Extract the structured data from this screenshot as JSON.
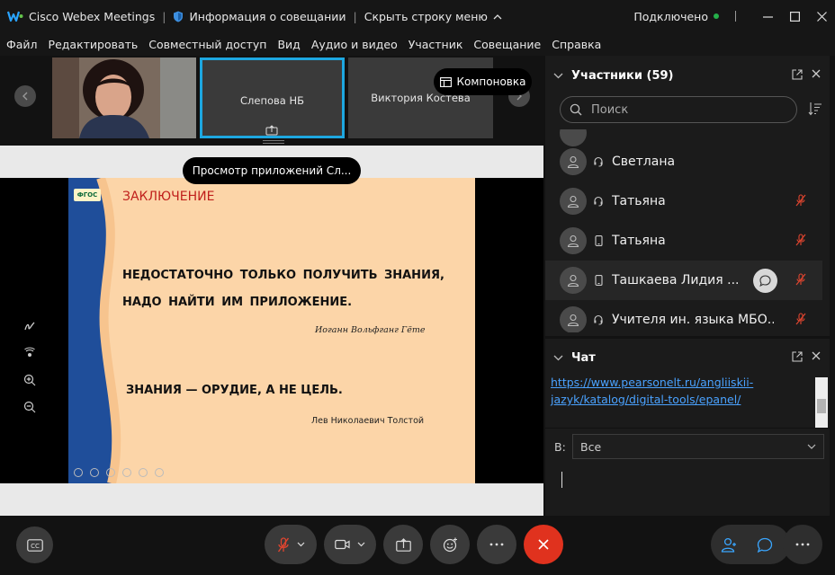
{
  "titlebar": {
    "app_name": "Cisco Webex Meetings",
    "meeting_info": "Информация о совещании",
    "hide_menu": "Скрыть строку меню",
    "status": "Подключено",
    "status_color": "#25b04a"
  },
  "menu": [
    "Файл",
    "Редактировать",
    "Совместный доступ",
    "Вид",
    "Аудио и видео",
    "Участник",
    "Совещание",
    "Справка"
  ],
  "thumbnails": [
    {
      "name": ""
    },
    {
      "name": "Слепова НБ"
    },
    {
      "name": "Виктория Костева"
    }
  ],
  "layout_button": "Компоновка",
  "share_tip": "Просмотр приложений Сл...",
  "slide": {
    "badge": "ФГОС",
    "title": "ЗАКЛЮЧЕНИЕ",
    "quote1_line1": "НЕДОСТАТОЧНО ТОЛЬКО ПОЛУЧИТЬ ЗНАНИЯ,",
    "quote1_line2": "НАДО НАЙТИ ИМ ПРИЛОЖЕНИЕ.",
    "author1": "Иоганн Вольфганг Гёте",
    "quote2": "ЗНАНИЯ — ОРУДИЕ, А НЕ ЦЕЛЬ.",
    "author2": "Лев Николаевич Толстой"
  },
  "participants": {
    "title": "Участники (59)",
    "search_placeholder": "Поиск",
    "list": [
      {
        "name": "Светлана",
        "device": "headset",
        "muted": false
      },
      {
        "name": "Татьяна",
        "device": "headset",
        "muted": true
      },
      {
        "name": "Татьяна",
        "device": "phone",
        "muted": true
      },
      {
        "name": "Ташкаева Лидия ...",
        "device": "phone",
        "muted": true
      },
      {
        "name": "Учителя ин. языка МБО...",
        "device": "headset",
        "muted": true
      }
    ]
  },
  "chat": {
    "title": "Чат",
    "link_text": "https://www.pearsonelt.ru/angliiskii-jazyk/katalog/digital-tools/epanel/",
    "to_label": "В:",
    "to_value": "Все"
  },
  "colors": {
    "accent_blue": "#1da7e0",
    "end_red": "#e0321e",
    "mute_red": "#e0452f"
  }
}
